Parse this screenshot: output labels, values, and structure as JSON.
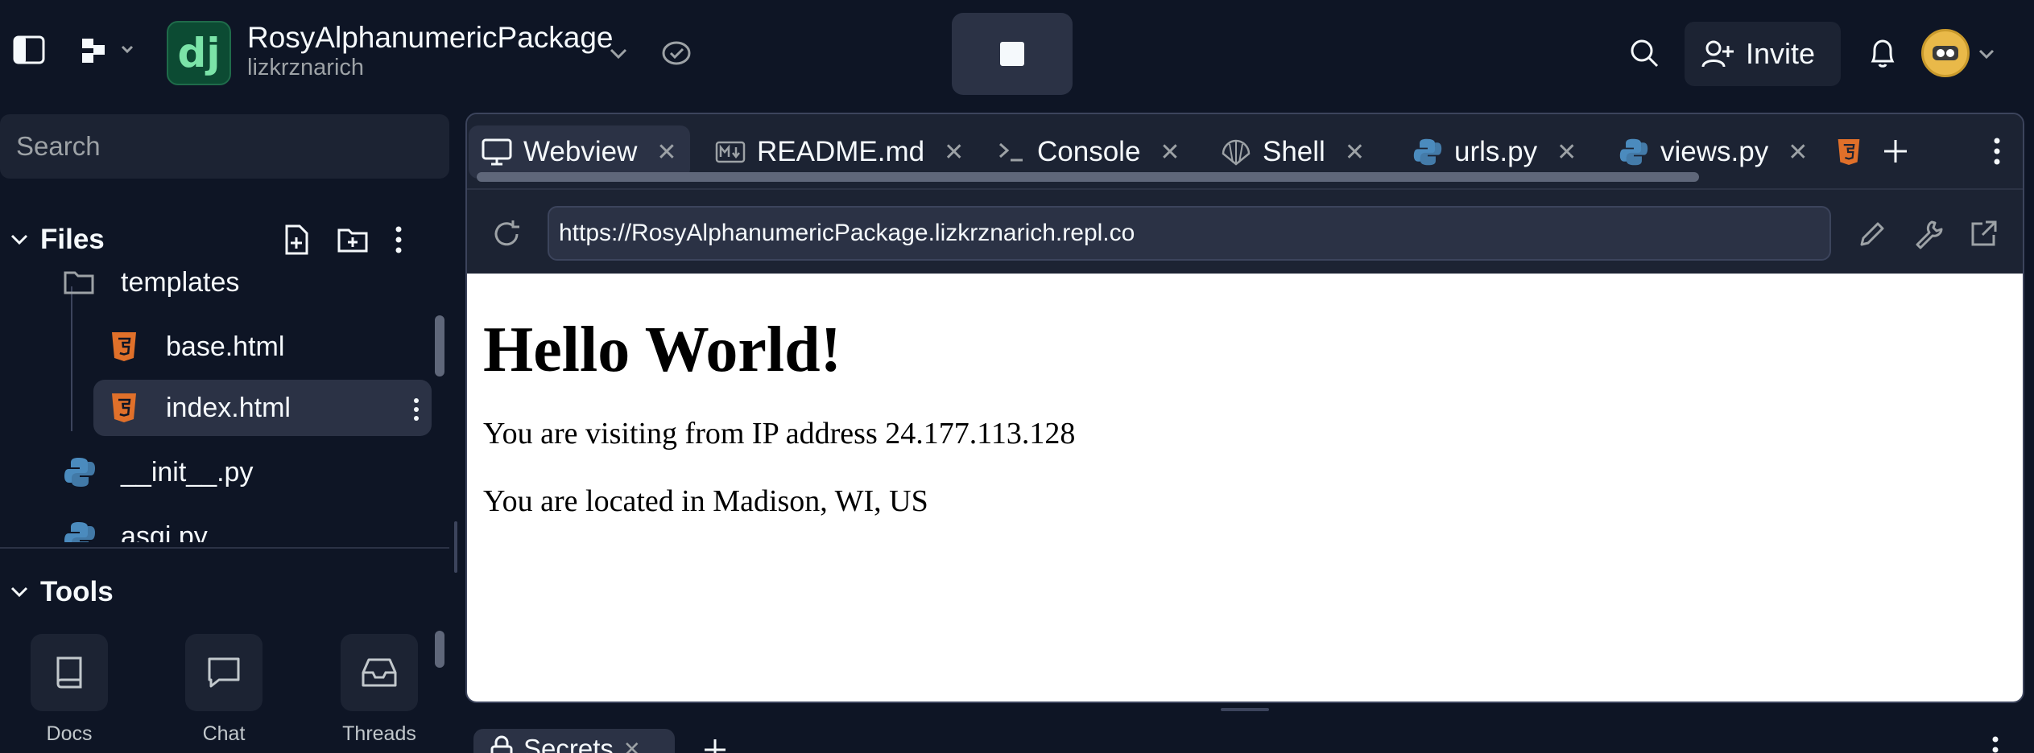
{
  "header": {
    "repl_name": "RosyAlphanumericPackage",
    "owner": "lizkrznarich",
    "logo_text": "dj",
    "invite_label": "Invite"
  },
  "sidebar": {
    "search_placeholder": "Search",
    "files_label": "Files",
    "tree": [
      {
        "label": "templates",
        "type": "folder"
      },
      {
        "label": "base.html",
        "type": "html"
      },
      {
        "label": "index.html",
        "type": "html",
        "selected": true
      },
      {
        "label": "__init__.py",
        "type": "python"
      },
      {
        "label": "asgi.py",
        "type": "python"
      }
    ],
    "tools_label": "Tools",
    "tools": [
      {
        "label": "Docs",
        "icon": "book-icon"
      },
      {
        "label": "Chat",
        "icon": "chat-bubble-icon"
      },
      {
        "label": "Threads",
        "icon": "inbox-icon"
      }
    ]
  },
  "tabs": [
    {
      "label": "Webview",
      "icon": "monitor-icon",
      "active": true
    },
    {
      "label": "README.md",
      "icon": "markdown-icon"
    },
    {
      "label": "Console",
      "icon": "terminal-icon"
    },
    {
      "label": "Shell",
      "icon": "shell-icon"
    },
    {
      "label": "urls.py",
      "icon": "python-icon"
    },
    {
      "label": "views.py",
      "icon": "python-icon"
    }
  ],
  "webview": {
    "url": "https://RosyAlphanumericPackage.lizkrznarich.repl.co",
    "heading": "Hello World!",
    "line1": "You are visiting from IP address 24.177.113.128",
    "line2": "You are located in Madison, WI, US"
  },
  "bottom": {
    "tab_label": "Secrets"
  },
  "colors": {
    "background": "#0e1525",
    "surface": "#1c2333",
    "surface_hover": "#2b3245",
    "html_orange": "#e0702a",
    "python_blue": "#4b8bbe",
    "django_green": "#0c4b33"
  }
}
